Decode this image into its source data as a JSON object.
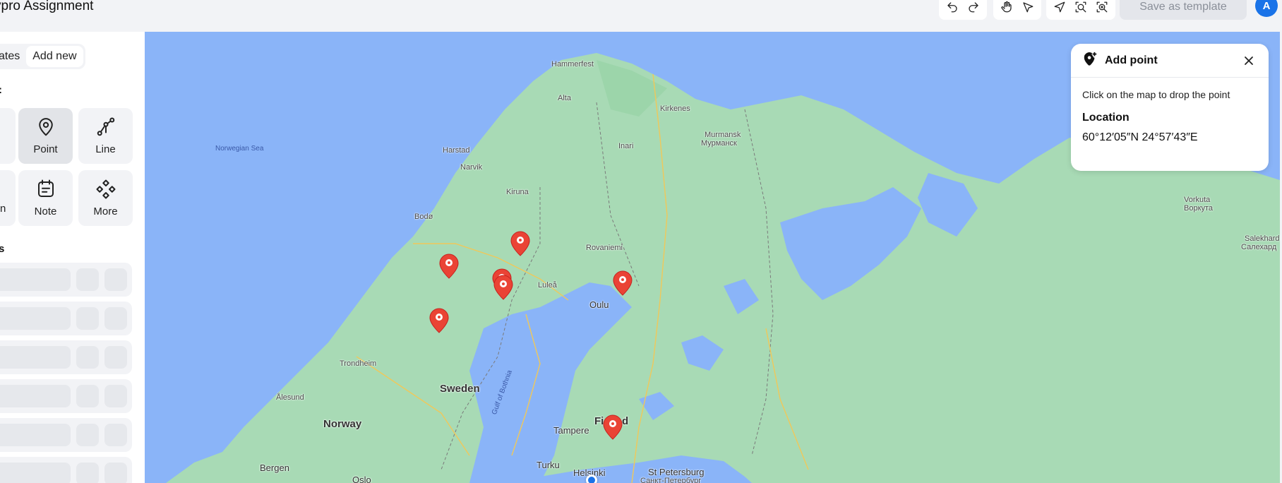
{
  "header": {
    "title": "ypro Assignment",
    "save_label": "Save as template",
    "avatar_initial": "A",
    "toolbar_icons": [
      "undo-icon",
      "redo-icon",
      "hand-icon",
      "pointer-icon",
      "navigate-icon",
      "zoom-area-icon",
      "zoom-fit-icon"
    ]
  },
  "sidebar": {
    "tabs": [
      {
        "label": "ates",
        "active": false
      },
      {
        "label": "Add new",
        "active": true
      }
    ],
    "tools_section_label": ":",
    "tools": [
      {
        "label": "Point",
        "icon": "point-icon",
        "active": true
      },
      {
        "label": "Line",
        "icon": "line-icon",
        "active": false
      },
      {
        "label": "n",
        "icon": "",
        "active": false
      },
      {
        "label": "Note",
        "icon": "note-icon",
        "active": false
      },
      {
        "label": "More",
        "icon": "more-icon",
        "active": false
      }
    ],
    "layers_section_label": "s",
    "layer_rows": 6
  },
  "map": {
    "labels": {
      "norwegian_sea": "Norwegian Sea",
      "hammerfest": "Hammerfest",
      "alta": "Alta",
      "kirkenes": "Kirkenes",
      "murmansk": "Murmansk",
      "murmansk_ru": "Мурманск",
      "harstad": "Harstad",
      "narvik": "Narvik",
      "inari": "Inari",
      "kiruna": "Kiruna",
      "bodo": "Bodø",
      "rovaniemi": "Rovaniemi",
      "lulea": "Luleå",
      "oulu": "Oulu",
      "trondheim": "Trondheim",
      "sweden": "Sweden",
      "gulf_of_bothnia": "Gulf of Bothnia",
      "alesund": "Ålesund",
      "norway": "Norway",
      "finland_f": "Fi",
      "finland_d": "d",
      "tampere": "Tampere",
      "bergen": "Bergen",
      "turku": "Turku",
      "helsinki": "Helsinki",
      "oslo": "Oslo",
      "st_petersburg": "St Petersburg",
      "st_petersburg_ru": "Санкт-Петербург",
      "vorkuta": "Vorkuta",
      "vorkuta_ru": "Воркута",
      "salekhard": "Salekhard",
      "salekhard_ru": "Салехард"
    },
    "marker_count": 7
  },
  "add_point_panel": {
    "title": "Add point",
    "hint": "Click on the map to drop the point",
    "location_label": "Location",
    "location_value": "60°12′05″N 24°57′43″E"
  }
}
